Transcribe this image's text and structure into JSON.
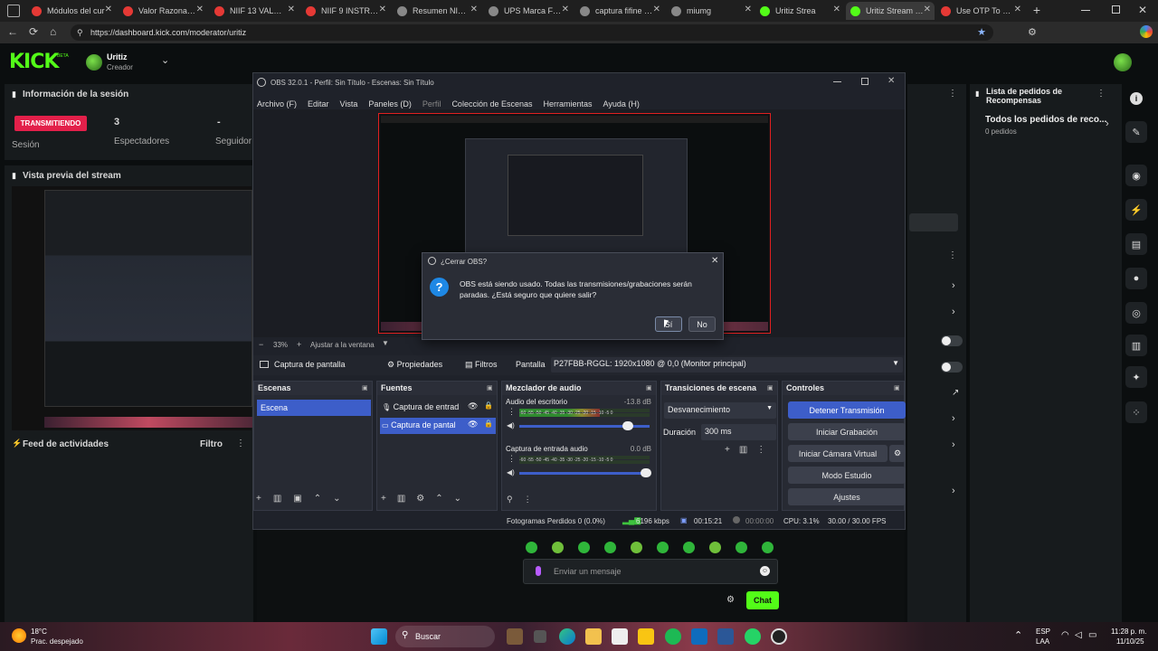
{
  "browser": {
    "tabs": [
      {
        "label": "Módulos del cur",
        "color": "#e53935"
      },
      {
        "label": "Valor Razonable",
        "color": "#e53935"
      },
      {
        "label": "NIIF 13 VALOR R",
        "color": "#e53935"
      },
      {
        "label": "NIIF 9 INSTRUM",
        "color": "#e53935"
      },
      {
        "label": "Resumen NIC 12",
        "color": "#888888"
      },
      {
        "label": "UPS Marca Fora",
        "color": "#888888"
      },
      {
        "label": "captura fifine gu",
        "color": "#888888"
      },
      {
        "label": "miumg",
        "color": "#888888"
      },
      {
        "label": "Uritiz Strea",
        "color": "#53fc18"
      },
      {
        "label": "Uritiz Stream - K",
        "color": "#53fc18"
      },
      {
        "label": "Use OTP To Proc",
        "color": "#e53935"
      }
    ],
    "url": "https://dashboard.kick.com/moderator/uritiz"
  },
  "kick": {
    "logo": "KICK",
    "logo_badge": "BETA",
    "user": {
      "name": "Uritiz",
      "role": "Creador"
    },
    "session": {
      "title": "Información de la sesión",
      "status": "TRANSMITIENDO",
      "status_label": "Sesión",
      "viewers_value": "3",
      "viewers_label": "Espectadores",
      "followers_value": "-",
      "followers_label": "Seguidor"
    },
    "preview_title": "Vista previa del stream",
    "feed": {
      "title": "Feed de actividades",
      "filter": "Filtro"
    },
    "rewards": {
      "title": "Lista de pedidos de Recompensas",
      "item": "Todos los pedidos de reco...",
      "count": "0 pedidos"
    },
    "chat": {
      "placeholder": "Enviar un mensaje",
      "send": "Chat"
    }
  },
  "obs": {
    "title": "OBS 32.0.1 - Perfil: Sin Título - Escenas: Sin Título",
    "menu": [
      "Archivo (F)",
      "Editar",
      "Vista",
      "Paneles (D)",
      "Perfil",
      "Colección de Escenas",
      "Herramientas",
      "Ayuda (H)"
    ],
    "zoom": "33%",
    "fit": "Ajustar a la ventana",
    "source_bar": {
      "source": "Captura de pantalla",
      "props": "Propiedades",
      "filters": "Filtros",
      "screen_label": "Pantalla",
      "screen_value": "P27FBB-RGGL: 1920x1080 @ 0,0 (Monitor principal)"
    },
    "scenes": {
      "title": "Escenas",
      "items": [
        "Escena"
      ]
    },
    "sources": {
      "title": "Fuentes",
      "items": [
        "Captura de entrad",
        "Captura de pantal"
      ]
    },
    "mixer": {
      "title": "Mezclador de audio",
      "channels": [
        {
          "name": "Audio del escritorio",
          "db": "-13.8 dB",
          "level": 0.62,
          "volume": 0.86
        },
        {
          "name": "Captura de entrada audio",
          "db": "0.0 dB",
          "level": 0.0,
          "volume": 1.0
        }
      ],
      "ticks": "-60 -55 -50 -45 -40 -35 -30 -25 -20 -15 -10 -5 0"
    },
    "transitions": {
      "title": "Transiciones de escena",
      "value": "Desvanecimiento",
      "duration_label": "Duración",
      "duration_value": "300 ms"
    },
    "controls": {
      "title": "Controles",
      "buttons": [
        "Detener Transmisión",
        "Iniciar Grabación",
        "Iniciar Cámara Virtual",
        "Modo Estudio",
        "Ajustes"
      ]
    },
    "status": {
      "frames": "Fotogramas Perdidos 0 (0.0%)",
      "bitrate": "6196 kbps",
      "live_time": "00:15:21",
      "rec_time": "00:00:00",
      "cpu": "CPU: 3.1%",
      "fps": "30.00 / 30.00 FPS"
    }
  },
  "dialog": {
    "title": "¿Cerrar OBS?",
    "message": "OBS está siendo usado. Todas las transmisiones/grabaciones serán paradas. ¿Está seguro que quiere salir?",
    "yes": "Sí",
    "no": "No"
  },
  "taskbar": {
    "temp": "18°C",
    "weather": "Prac. despejado",
    "search": "Buscar",
    "lang": "ESP",
    "region": "LAA",
    "time": "11:28 p. m.",
    "date": "11/10/25"
  }
}
